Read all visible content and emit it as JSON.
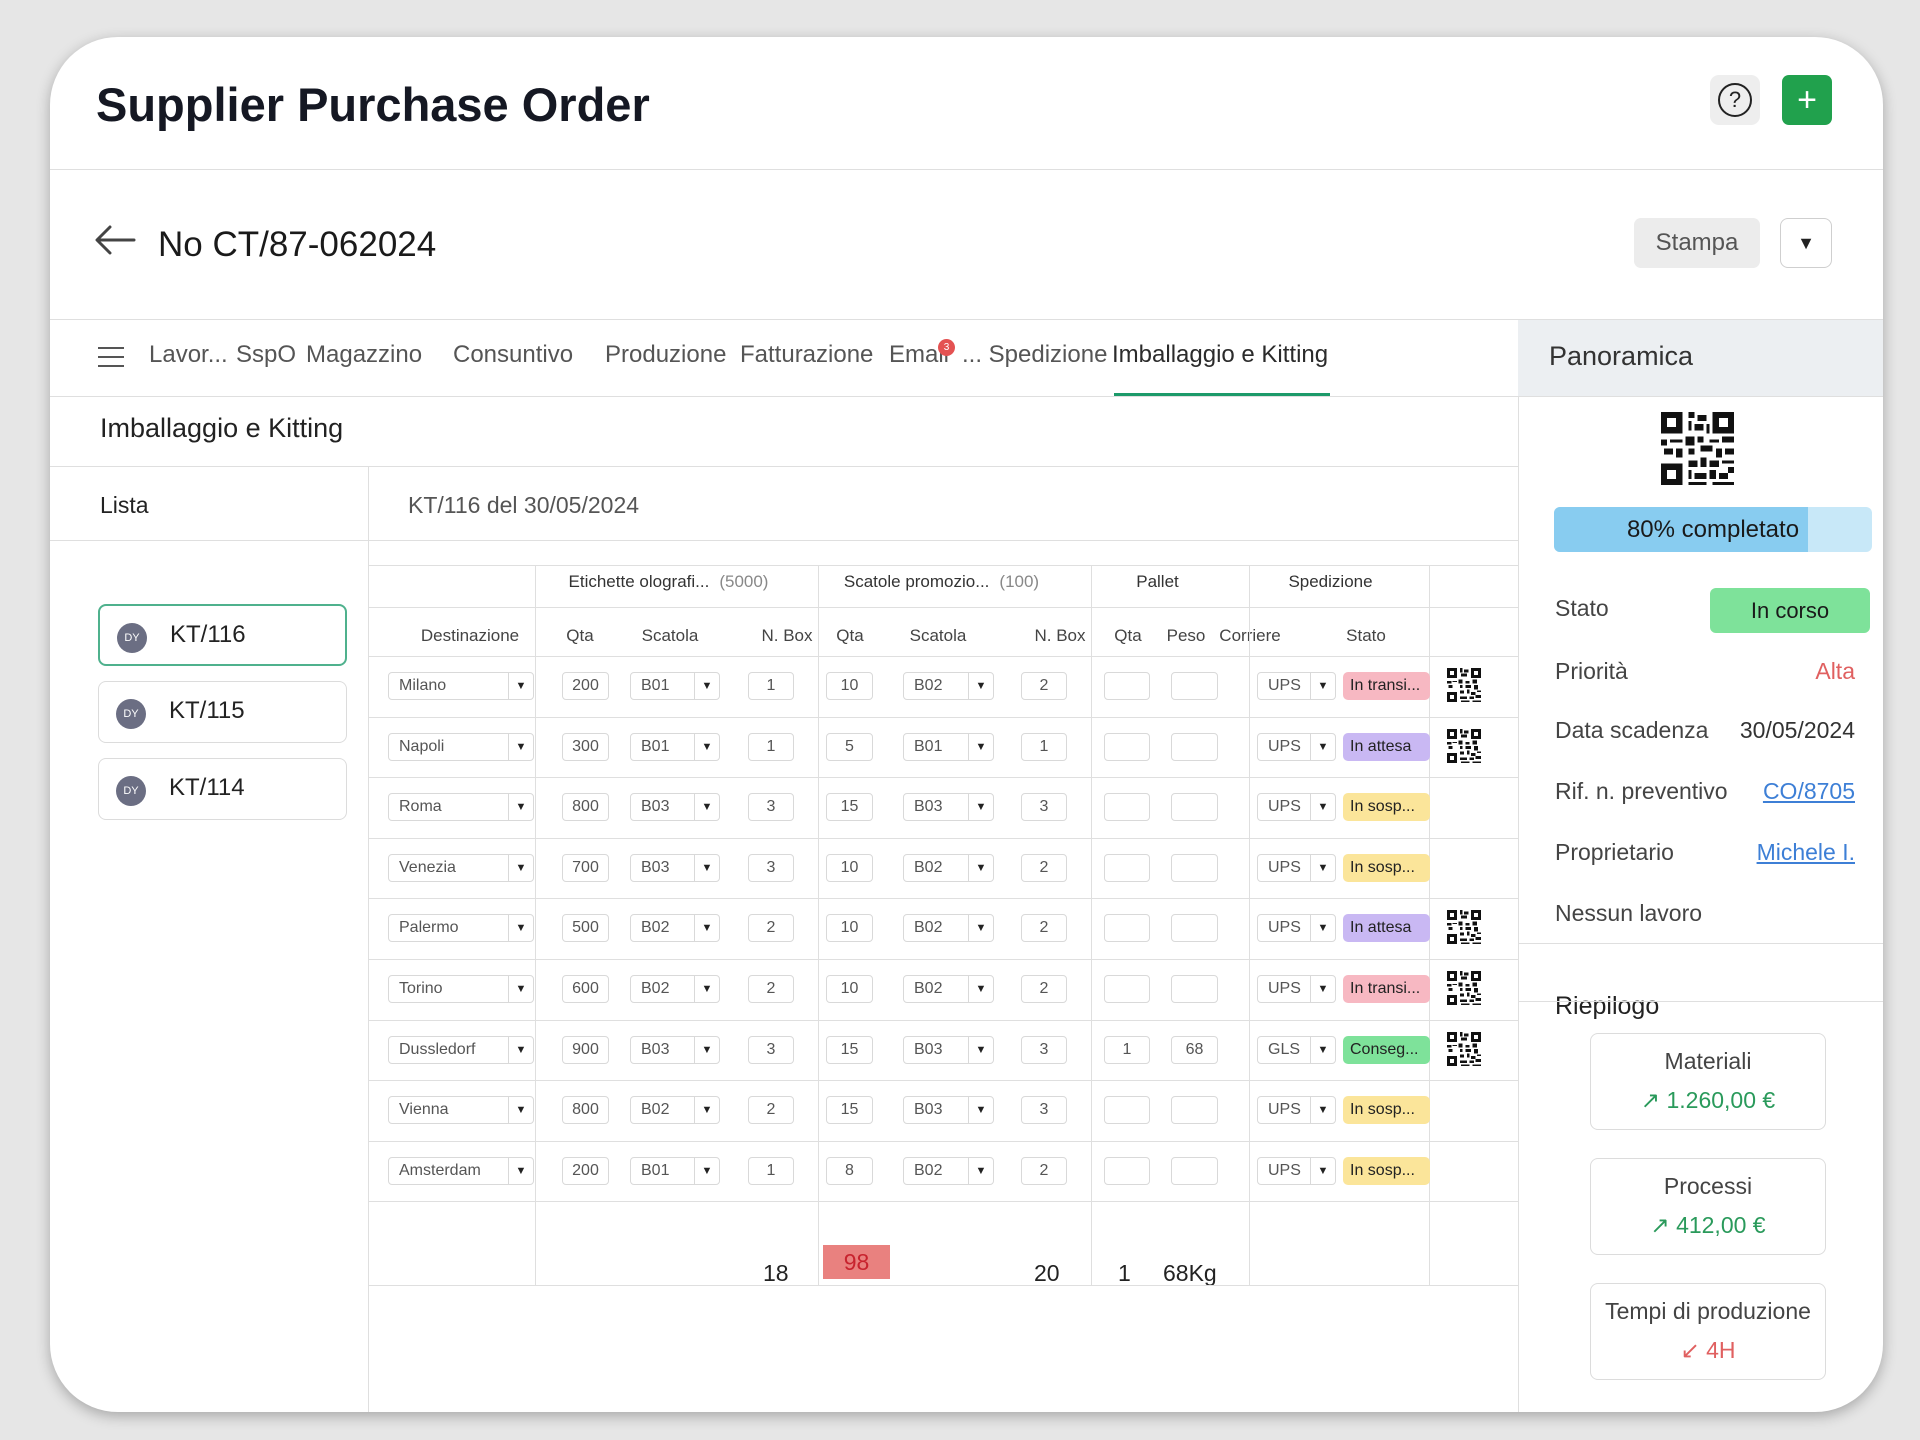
{
  "header": {
    "title": "Supplier Purchase Order",
    "help_icon": "?",
    "add_icon": "+"
  },
  "doc": {
    "number": "No CT/87-062024",
    "print_label": "Stampa",
    "dropdown_icon": "▼"
  },
  "tabs": [
    {
      "label": "Lavor..."
    },
    {
      "label": "SspO"
    },
    {
      "label": "Magazzino"
    },
    {
      "label": "Consuntivo"
    },
    {
      "label": "Produzione"
    },
    {
      "label": "Fatturazione"
    },
    {
      "label": "Email",
      "badge": "3"
    },
    {
      "label": "... Spedizione"
    },
    {
      "label": "Imballaggio e Kitting",
      "active": true
    }
  ],
  "section_title": "Imballaggio e Kitting",
  "list": {
    "title": "Lista",
    "items": [
      {
        "avatar": "DY",
        "label": "KT/116",
        "active": true
      },
      {
        "avatar": "DY",
        "label": "KT/115"
      },
      {
        "avatar": "DY",
        "label": "KT/114"
      }
    ]
  },
  "detail": {
    "title": "KT/116 del 30/05/2024",
    "groups": {
      "etichette": {
        "label": "Etichette olografi...",
        "qty": "(5000)"
      },
      "scatole": {
        "label": "Scatole promozio...",
        "qty": "(100)"
      },
      "pallet": {
        "label": "Pallet"
      },
      "spedizione": {
        "label": "Spedizione"
      }
    },
    "columns": [
      "Destinazione",
      "Qta",
      "Scatola",
      "N. Box",
      "Qta",
      "Scatola",
      "N. Box",
      "Qta",
      "Peso",
      "Corriere",
      "Stato"
    ],
    "rows": [
      {
        "dest": "Milano",
        "q1": "200",
        "s1": "B01",
        "b1": "1",
        "q2": "10",
        "s2": "B02",
        "b2": "2",
        "pq": "",
        "pw": "",
        "carrier": "UPS",
        "status": "In transi...",
        "status_color": "#f7b8c2",
        "qr": true
      },
      {
        "dest": "Napoli",
        "q1": "300",
        "s1": "B01",
        "b1": "1",
        "q2": "5",
        "s2": "B01",
        "b2": "1",
        "pq": "",
        "pw": "",
        "carrier": "UPS",
        "status": "In attesa",
        "status_color": "#c9b8f3",
        "qr": true
      },
      {
        "dest": "Roma",
        "q1": "800",
        "s1": "B03",
        "b1": "3",
        "q2": "15",
        "s2": "B03",
        "b2": "3",
        "pq": "",
        "pw": "",
        "carrier": "UPS",
        "status": "In sosp...",
        "status_color": "#fbe59a",
        "qr": false
      },
      {
        "dest": "Venezia",
        "q1": "700",
        "s1": "B03",
        "b1": "3",
        "q2": "10",
        "s2": "B02",
        "b2": "2",
        "pq": "",
        "pw": "",
        "carrier": "UPS",
        "status": "In sosp...",
        "status_color": "#fbe59a",
        "qr": false
      },
      {
        "dest": "Palermo",
        "q1": "500",
        "s1": "B02",
        "b1": "2",
        "q2": "10",
        "s2": "B02",
        "b2": "2",
        "pq": "",
        "pw": "",
        "carrier": "UPS",
        "status": "In attesa",
        "status_color": "#c9b8f3",
        "qr": true
      },
      {
        "dest": "Torino",
        "q1": "600",
        "s1": "B02",
        "b1": "2",
        "q2": "10",
        "s2": "B02",
        "b2": "2",
        "pq": "",
        "pw": "",
        "carrier": "UPS",
        "status": "In transi...",
        "status_color": "#f7b8c2",
        "qr": true
      },
      {
        "dest": "Dussledorf",
        "q1": "900",
        "s1": "B03",
        "b1": "3",
        "q2": "15",
        "s2": "B03",
        "b2": "3",
        "pq": "1",
        "pw": "68",
        "carrier": "GLS",
        "status": "Conseg...",
        "status_color": "#7ee29a",
        "qr": true
      },
      {
        "dest": "Vienna",
        "q1": "800",
        "s1": "B02",
        "b1": "2",
        "q2": "15",
        "s2": "B03",
        "b2": "3",
        "pq": "",
        "pw": "",
        "carrier": "UPS",
        "status": "In sosp...",
        "status_color": "#fbe59a",
        "qr": false
      },
      {
        "dest": "Amsterdam",
        "q1": "200",
        "s1": "B01",
        "b1": "1",
        "q2": "8",
        "s2": "B02",
        "b2": "2",
        "pq": "",
        "pw": "",
        "carrier": "UPS",
        "status": "In sosp...",
        "status_color": "#fbe59a",
        "qr": false
      }
    ],
    "totals": {
      "box1": "18",
      "qta2": "98",
      "box2": "20",
      "pallet_qta": "1",
      "pallet_peso": "68Kg"
    }
  },
  "overview": {
    "title": "Panoramica",
    "progress_label": "80% completato",
    "progress": 0.8,
    "fields": [
      {
        "label": "Stato",
        "value": "In corso",
        "type": "badge"
      },
      {
        "label": "Priorità",
        "value": "Alta",
        "color": "#e06060"
      },
      {
        "label": "Data scadenza",
        "value": "30/05/2024"
      },
      {
        "label": "Rif. n. preventivo",
        "value": "CO/8705",
        "type": "link"
      },
      {
        "label": "Proprietario",
        "value": "Michele I.",
        "type": "link"
      },
      {
        "label": "Nessun lavoro",
        "value": ""
      }
    ],
    "summary_title": "Riepilogo",
    "cards": [
      {
        "title": "Materiali",
        "value": "1.260,00 €",
        "trend": "up",
        "arrow": "↗"
      },
      {
        "title": "Processi",
        "value": "412,00 €",
        "trend": "up",
        "arrow": "↗"
      },
      {
        "title": "Tempi di produzione",
        "value": "4H",
        "trend": "down",
        "arrow": "↙"
      }
    ]
  }
}
